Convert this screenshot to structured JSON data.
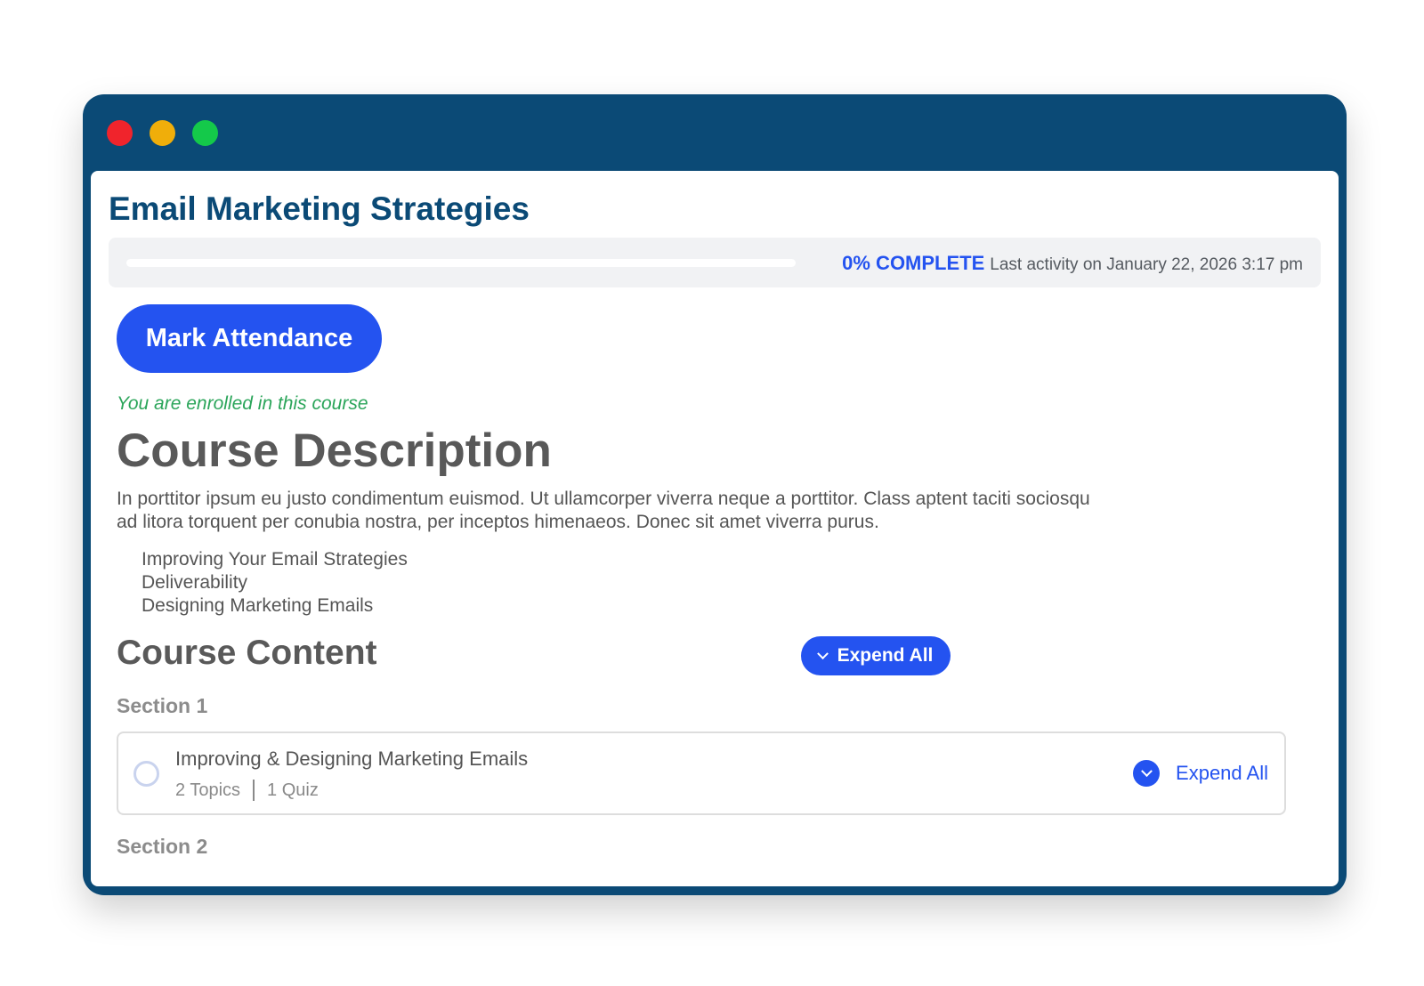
{
  "window": {
    "controls": [
      "close",
      "minimize",
      "maximize"
    ]
  },
  "course": {
    "title": "Email Marketing Strategies"
  },
  "progress": {
    "percent": 0,
    "percent_label": "0% COMPLETE",
    "last_activity": "Last activity on January 22, 2026 3:17 pm"
  },
  "actions": {
    "mark_attendance": "Mark Attendance"
  },
  "enrollment": {
    "status_text": "You are enrolled in this course"
  },
  "description": {
    "heading": "Course Description",
    "paragraph": "In porttitor ipsum eu justo condimentum euismod. Ut ullamcorper viverra neque a porttitor. Class aptent taciti sociosqu ad litora torquent per conubia nostra, per inceptos himenaeos. Donec sit amet viverra purus.",
    "items": [
      "Improving Your Email Strategies",
      "Deliverability",
      "Designing Marketing Emails"
    ]
  },
  "course_content": {
    "heading": "Course Content",
    "expand_all_label": "Expend All",
    "sections": [
      {
        "label": "Section 1",
        "lessons": [
          {
            "title": "Improving & Designing Marketing Emails",
            "topics": "2 Topics",
            "quizzes": "1 Quiz",
            "expand_label": "Expend All"
          }
        ]
      },
      {
        "label": "Section 2"
      }
    ]
  },
  "colors": {
    "frame": "#0b4a76",
    "accent": "#2453f0",
    "success": "#2ba55a",
    "heading": "#595959"
  }
}
